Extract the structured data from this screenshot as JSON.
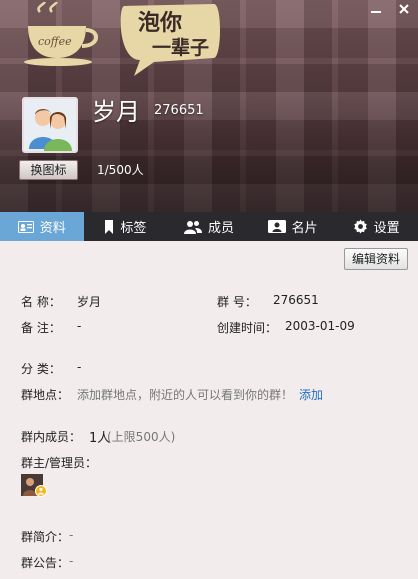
{
  "header": {
    "group_name": "岁月",
    "group_number": "276651",
    "change_icon_label": "换图标",
    "member_count": "1/500人",
    "logo_text": "泡你 一辈子",
    "window_buttons": [
      "−",
      "×"
    ]
  },
  "tabs": [
    {
      "label": "资料",
      "icon": "id-card-icon",
      "active": true
    },
    {
      "label": "标签",
      "icon": "bookmark-icon",
      "active": false
    },
    {
      "label": "成员",
      "icon": "members-icon",
      "active": false
    },
    {
      "label": "名片",
      "icon": "card-icon",
      "active": false
    },
    {
      "label": "设置",
      "icon": "gear-icon",
      "active": false
    }
  ],
  "profile": {
    "edit_label": "编辑资料",
    "name_label": "名    称：",
    "name_value": "岁月",
    "number_label": "群    号：",
    "number_value": "276651",
    "note_label": "备    注：",
    "note_value": "-",
    "created_label": "创建时间：",
    "created_value": "2003-01-09",
    "category_label": "分    类：",
    "category_value": "-",
    "location_label": "群地点：",
    "location_hint": "添加群地点，附近的人可以看到你的群！",
    "location_add": "添加",
    "members_label": "群内成员：",
    "members_value": "1人",
    "members_limit": "(上限500人)",
    "admin_label": "群主/管理员：",
    "intro_label": "群简介：",
    "intro_value": "-",
    "notice_label": "群公告：",
    "notice_value": "-"
  },
  "colors": {
    "accent_tab": "#6aa7d6",
    "tab_bar": "#2a2a2e",
    "link": "#1f6fc5",
    "content_bg": "#f2ecec"
  }
}
